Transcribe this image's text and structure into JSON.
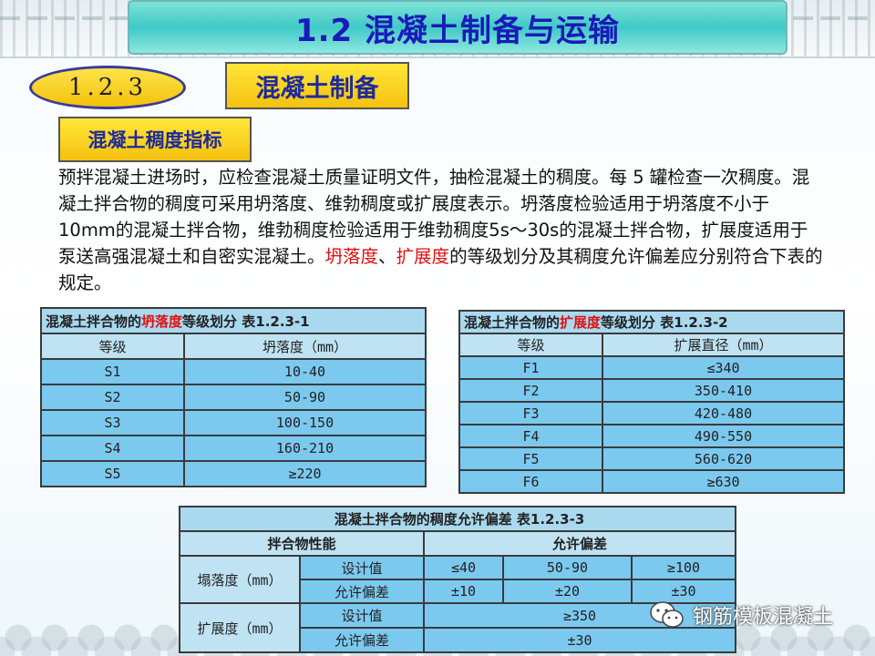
{
  "slide": {
    "title": "1.2 混凝土制备与运输",
    "section_number": "1.2.3",
    "section_title": "混凝土制备",
    "subsection_title": "混凝土稠度指标",
    "paragraph": {
      "part1": "预拌混凝土进场时，应检查混凝土质量证明文件，抽检混凝土的稠度。每 5 罐检查一次稠度。混凝土拌合物的稠度可采用坍落度、维勃稠度或扩展度表示。坍落度检验适用于坍落度不小于10mm的混凝土拌合物，维勃稠度检验适用于维勃稠度5s～30s的混凝土拌合物，扩展度适用于泵送高强混凝土和自密实混凝土。",
      "red1": "坍落度",
      "sep": "、",
      "red2": "扩展度",
      "part2": "的等级划分及其稠度允许偏差应分别符合下表的规定。"
    }
  },
  "table1": {
    "caption_pre": "混凝土拌合物的",
    "caption_red": "坍落度",
    "caption_post": "等级划分 表1.2.3-1",
    "headers": [
      "等级",
      "坍落度（mm）"
    ],
    "rows": [
      [
        "S1",
        "10-40"
      ],
      [
        "S2",
        "50-90"
      ],
      [
        "S3",
        "100-150"
      ],
      [
        "S4",
        "160-210"
      ],
      [
        "S5",
        "≥220"
      ]
    ]
  },
  "table2": {
    "caption_pre": "混凝土拌合物的",
    "caption_red": "扩展度",
    "caption_post": "等级划分 表1.2.3-2",
    "headers": [
      "等级",
      "扩展直径（mm）"
    ],
    "rows": [
      [
        "F1",
        "≤340"
      ],
      [
        "F2",
        "350-410"
      ],
      [
        "F3",
        "420-480"
      ],
      [
        "F4",
        "490-550"
      ],
      [
        "F5",
        "560-620"
      ],
      [
        "F6",
        "≥630"
      ]
    ]
  },
  "table3": {
    "caption": "混凝土拌合物的稠度允许偏差 表1.2.3-3",
    "header_left": "拌合物性能",
    "header_right": "允许偏差",
    "slump_label": "塌落度（mm）",
    "spread_label": "扩展度（mm）",
    "design_label": "设计值",
    "tolerance_label": "允许偏差",
    "slump_design": [
      "≤40",
      "50-90",
      "≥100"
    ],
    "slump_tolerance": [
      "±10",
      "±20",
      "±30"
    ],
    "spread_design": "≥350",
    "spread_tolerance": "±30"
  },
  "watermark": {
    "text": "钢筋模板混凝土",
    "icon": "wechat-icon"
  },
  "colors": {
    "title_text": "#1a1ab8",
    "cell_blue": "#7cc9ef",
    "header_blue": "#bfe3f3",
    "highlight_red": "#e01010"
  }
}
